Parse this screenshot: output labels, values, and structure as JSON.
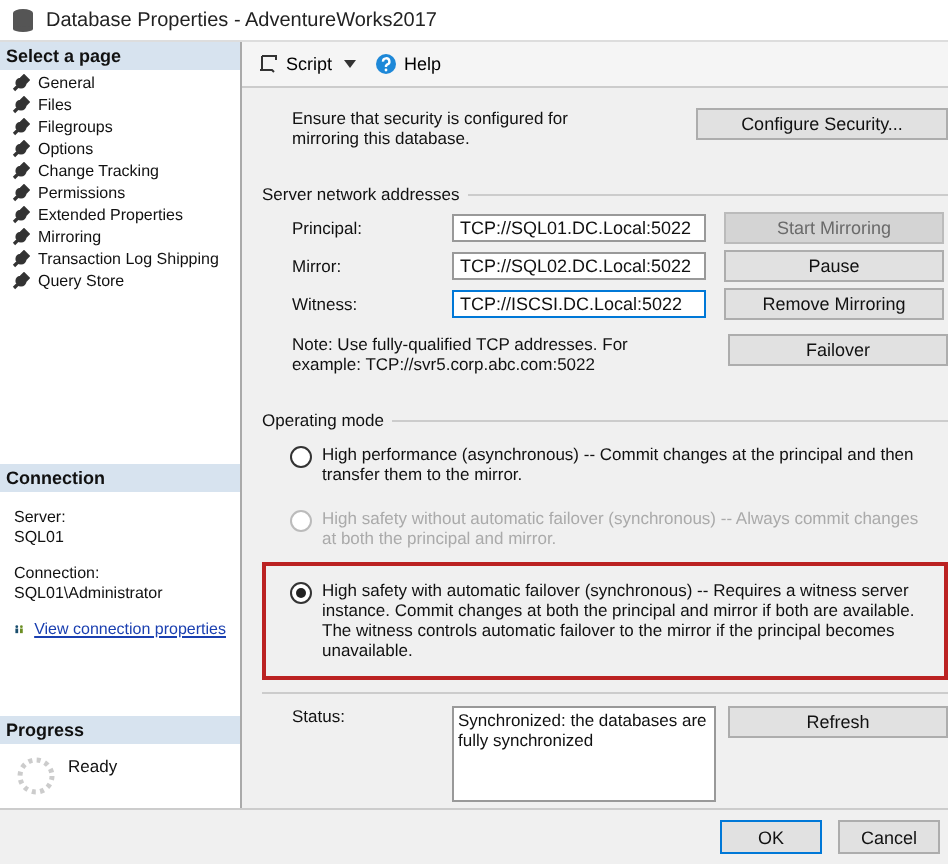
{
  "window": {
    "title": "Database Properties - AdventureWorks2017"
  },
  "sidebar": {
    "heading": "Select a page",
    "items": [
      {
        "label": "General",
        "selected": false
      },
      {
        "label": "Files",
        "selected": false
      },
      {
        "label": "Filegroups",
        "selected": false
      },
      {
        "label": "Options",
        "selected": false
      },
      {
        "label": "Change Tracking",
        "selected": false
      },
      {
        "label": "Permissions",
        "selected": false
      },
      {
        "label": "Extended Properties",
        "selected": false
      },
      {
        "label": "Mirroring",
        "selected": false
      },
      {
        "label": "Transaction Log Shipping",
        "selected": false
      },
      {
        "label": "Query Store",
        "selected": false
      }
    ]
  },
  "connection": {
    "heading": "Connection",
    "server_label": "Server:",
    "server": "SQL01",
    "connection_label": "Connection:",
    "connection": "SQL01\\Administrator",
    "link": "View connection properties"
  },
  "progress": {
    "heading": "Progress",
    "status": "Ready"
  },
  "toolbar": {
    "script": "Script",
    "help": "Help"
  },
  "security": {
    "text": "Ensure that security is configured for mirroring this database.",
    "button": "Configure Security..."
  },
  "addresses": {
    "heading": "Server network addresses",
    "rows": [
      {
        "label": "Principal:",
        "value": "TCP://SQL01.DC.Local:5022",
        "focused": false,
        "button": "Start Mirroring",
        "disabled": true
      },
      {
        "label": "Mirror:",
        "value": "TCP://SQL02.DC.Local:5022",
        "focused": false,
        "button": "Pause",
        "disabled": false
      },
      {
        "label": "Witness:",
        "value": "TCP://ISCSI.DC.Local:5022",
        "focused": true,
        "button": "Remove Mirroring",
        "disabled": false
      }
    ],
    "note": "Note: Use fully-qualified TCP addresses. For example: TCP://svr5.corp.abc.com:5022",
    "failover": "Failover"
  },
  "operating_mode": {
    "heading": "Operating mode",
    "options": [
      {
        "label": "High performance (asynchronous) -- Commit changes at the principal and then transfer them to the mirror.",
        "selected": false,
        "disabled": false,
        "highlighted": false
      },
      {
        "label": "High safety without automatic failover (synchronous) -- Always commit changes at both the principal and mirror.",
        "selected": false,
        "disabled": true,
        "highlighted": false
      },
      {
        "label": "High safety with automatic failover (synchronous) -- Requires a witness server instance. Commit changes at both the principal and mirror if both are available. The witness controls automatic failover to the mirror if the principal becomes unavailable.",
        "selected": true,
        "disabled": false,
        "highlighted": true
      }
    ]
  },
  "status": {
    "label": "Status:",
    "value": "Synchronized: the databases are fully synchronized",
    "button": "Refresh"
  },
  "buttons": [
    {
      "label": "OK",
      "default": true
    },
    {
      "label": "Cancel",
      "default": false
    }
  ]
}
